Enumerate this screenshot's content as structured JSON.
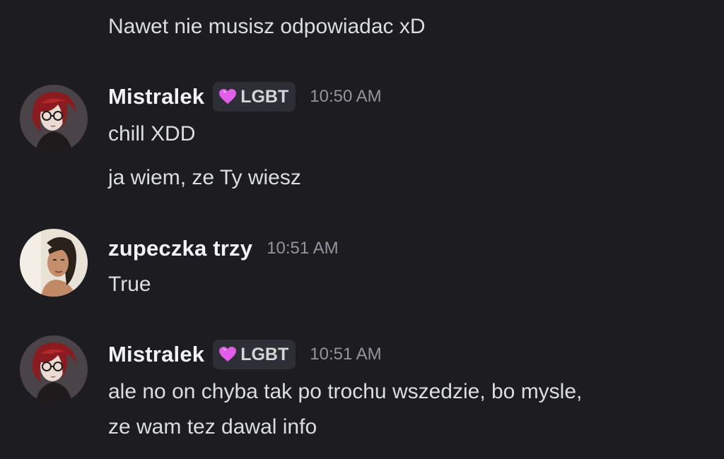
{
  "channel": {
    "messages": [
      {
        "lines": [
          "Nawet nie musisz odpowiadac xD"
        ]
      },
      {
        "author": "Mistralek",
        "avatar_icon": "user-avatar",
        "tag": {
          "icon": "pink-heart-icon",
          "label": "LGBT",
          "heart_color": "#e15ee8"
        },
        "time": "10:50 AM",
        "lines": [
          "chill XDD",
          "ja wiem, ze Ty wiesz"
        ]
      },
      {
        "author": "zupeczka trzy",
        "avatar_icon": "user-avatar",
        "time": "10:51 AM",
        "lines": [
          "True"
        ]
      },
      {
        "author": "Mistralek",
        "avatar_icon": "user-avatar",
        "tag": {
          "icon": "pink-heart-icon",
          "label": "LGBT",
          "heart_color": "#e15ee8"
        },
        "time": "10:51 AM",
        "lines": [
          "ale no on chyba tak po trochu wszedzie, bo mysle,",
          "ze wam tez dawal info"
        ]
      }
    ]
  },
  "theme": {
    "background": "#1c1c21",
    "text": "#dbdee1",
    "username": "#f2f3f5",
    "timestamp": "#94969c",
    "tag_background": "#2e2f36"
  }
}
